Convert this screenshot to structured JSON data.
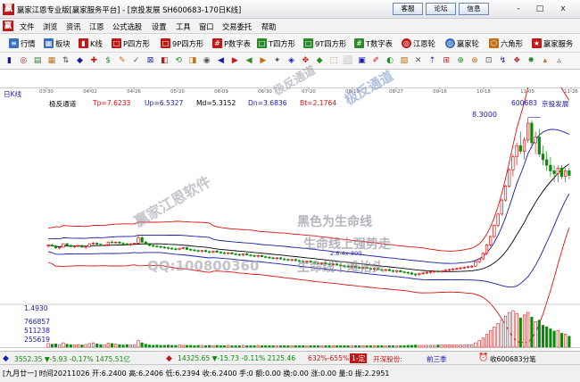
{
  "window": {
    "title": "赢家江恩专业版[赢家服务平台] - [京投发展  SH600683-170日K线]",
    "buttons": [
      "客服",
      "论坛",
      "信息"
    ],
    "controls": [
      "-",
      "□",
      "x"
    ]
  },
  "menu": [
    "文件",
    "浏览",
    "资讯",
    "江恩",
    "公式选股",
    "设置",
    "工具",
    "窗口",
    "交易委托",
    "帮助"
  ],
  "toolbar": [
    "行情",
    "板块",
    "K线",
    "P四方形",
    "9P四方形",
    "P数字表",
    "T四方形",
    "9T四方形",
    "T数字表",
    "江恩轮",
    "赢家轮",
    "六角形",
    "赢家服务"
  ],
  "chart": {
    "period_label": "日K线",
    "date_ticks": [
      "03-30",
      "04-02",
      "04-26",
      "05-20",
      "06-09",
      "06-30",
      "07-20",
      "08-10",
      "08-27",
      "09-16",
      "10-18",
      "11-05",
      "11-26"
    ],
    "indicator_name": "极反通道",
    "indicator_values": [
      {
        "label": "Tp=7.6233",
        "color": "#e01010"
      },
      {
        "label": "Up=6.5327",
        "color": "#1a1aa8"
      },
      {
        "label": "Md=5.3152",
        "color": "#000000"
      },
      {
        "label": "Dn=3.6836",
        "color": "#1a1aa8"
      },
      {
        "label": "Bt=2.1764",
        "color": "#e01010"
      }
    ],
    "stock_code": "600683",
    "stock_name": "京投发展",
    "price_high_label": "8.3000",
    "price_low_label": "2.6-4x-800",
    "volume_labels": [
      "1.4930",
      "766857",
      "511238",
      "255619"
    ]
  },
  "watermarks": {
    "vertical": "极反通道",
    "brand": "赢家江恩软件",
    "qq": "QQ:100800360",
    "black_line": "黑色为生命线",
    "above_line": "生命线上强势走",
    "below_line": "生命线下难抬头"
  },
  "status1": {
    "index1": "3552.35 ▼-5.93 -0.17% 1475.51亿",
    "index2": "14325.65 ▼-15.73 -0.11% 2125.46",
    "pct": "632%-655%",
    "badge": "1-定",
    "open_label": "开深股份:",
    "upcoming": "前三季",
    "stock_name": "收600683分笔"
  },
  "status2": {
    "text": "[九月廿一] 时间20211026 开:6.2400 高:6.2406 低:6.2394 收:6.2400 手:0 额:0.00 换:0.00 涨:0.00 量:0 振:2.2951"
  },
  "colors": {
    "brand": "#c01818",
    "up": "#e01010",
    "down": "#0a8a0a",
    "channel": "#1a1aa8",
    "text_blue": "#1a1aa8"
  },
  "ohlc": [
    [
      3.72,
      3.78,
      3.66,
      3.75
    ],
    [
      3.75,
      3.8,
      3.7,
      3.72
    ],
    [
      3.72,
      3.76,
      3.62,
      3.65
    ],
    [
      3.65,
      3.7,
      3.6,
      3.68
    ],
    [
      3.68,
      3.82,
      3.66,
      3.8
    ],
    [
      3.8,
      3.84,
      3.72,
      3.74
    ],
    [
      3.74,
      3.78,
      3.68,
      3.7
    ],
    [
      3.7,
      3.74,
      3.64,
      3.72
    ],
    [
      3.72,
      3.76,
      3.68,
      3.74
    ],
    [
      3.74,
      3.76,
      3.66,
      3.68
    ],
    [
      3.68,
      3.72,
      3.62,
      3.7
    ],
    [
      3.7,
      3.82,
      3.68,
      3.8
    ],
    [
      3.8,
      3.86,
      3.76,
      3.82
    ],
    [
      3.82,
      3.86,
      3.76,
      3.78
    ],
    [
      3.78,
      3.82,
      3.72,
      3.74
    ],
    [
      3.74,
      3.78,
      3.7,
      3.76
    ],
    [
      3.76,
      3.88,
      3.74,
      3.86
    ],
    [
      3.86,
      3.92,
      3.82,
      3.84
    ],
    [
      3.84,
      3.88,
      3.8,
      3.86
    ],
    [
      3.86,
      3.9,
      3.8,
      3.82
    ],
    [
      3.82,
      3.86,
      3.76,
      3.8
    ],
    [
      3.8,
      3.84,
      3.74,
      3.78
    ],
    [
      3.78,
      3.82,
      3.72,
      3.8
    ],
    [
      3.8,
      3.84,
      3.76,
      3.82
    ],
    [
      3.82,
      4.12,
      3.8,
      4.02
    ],
    [
      4.02,
      4.08,
      3.82,
      3.86
    ],
    [
      3.86,
      3.9,
      3.76,
      3.78
    ],
    [
      3.78,
      3.82,
      3.7,
      3.74
    ],
    [
      3.74,
      3.78,
      3.68,
      3.72
    ],
    [
      3.72,
      3.76,
      3.66,
      3.7
    ],
    [
      3.7,
      3.74,
      3.64,
      3.68
    ],
    [
      3.68,
      3.72,
      3.62,
      3.66
    ],
    [
      3.66,
      3.7,
      3.6,
      3.64
    ],
    [
      3.64,
      3.68,
      3.58,
      3.62
    ],
    [
      3.62,
      3.66,
      3.56,
      3.6
    ],
    [
      3.6,
      3.66,
      3.56,
      3.64
    ],
    [
      3.64,
      3.7,
      3.6,
      3.66
    ],
    [
      3.66,
      3.7,
      3.58,
      3.6
    ],
    [
      3.6,
      3.64,
      3.54,
      3.58
    ],
    [
      3.58,
      3.62,
      3.52,
      3.56
    ],
    [
      3.56,
      3.6,
      3.5,
      3.54
    ],
    [
      3.54,
      3.58,
      3.48,
      3.56
    ],
    [
      3.56,
      3.6,
      3.5,
      3.52
    ],
    [
      3.52,
      3.56,
      3.46,
      3.5
    ],
    [
      3.5,
      3.56,
      3.46,
      3.54
    ],
    [
      3.54,
      3.58,
      3.48,
      3.5
    ],
    [
      3.5,
      3.54,
      3.44,
      3.48
    ],
    [
      3.48,
      3.52,
      3.42,
      3.46
    ],
    [
      3.46,
      3.5,
      3.4,
      3.48
    ],
    [
      3.48,
      3.52,
      3.42,
      3.44
    ],
    [
      3.44,
      3.48,
      3.38,
      3.42
    ],
    [
      3.42,
      3.46,
      3.36,
      3.4
    ],
    [
      3.4,
      3.46,
      3.36,
      3.44
    ],
    [
      3.44,
      3.48,
      3.38,
      3.4
    ],
    [
      3.4,
      3.44,
      3.34,
      3.38
    ],
    [
      3.38,
      3.42,
      3.32,
      3.36
    ],
    [
      3.36,
      3.4,
      3.3,
      3.38
    ],
    [
      3.38,
      3.42,
      3.32,
      3.34
    ],
    [
      3.34,
      3.38,
      3.28,
      3.32
    ],
    [
      3.32,
      3.36,
      3.26,
      3.3
    ],
    [
      3.3,
      3.34,
      3.24,
      3.28
    ],
    [
      3.28,
      3.32,
      3.22,
      3.3
    ],
    [
      3.3,
      3.34,
      3.24,
      3.26
    ],
    [
      3.26,
      3.3,
      3.2,
      3.24
    ],
    [
      3.24,
      3.28,
      3.18,
      3.22
    ],
    [
      3.22,
      3.26,
      3.16,
      3.24
    ],
    [
      3.24,
      3.28,
      3.18,
      3.2
    ],
    [
      3.2,
      3.24,
      3.14,
      3.18
    ],
    [
      3.18,
      3.22,
      3.12,
      3.16
    ],
    [
      3.16,
      3.2,
      3.1,
      3.18
    ],
    [
      3.18,
      3.22,
      3.12,
      3.14
    ],
    [
      3.14,
      3.18,
      3.08,
      3.12
    ],
    [
      3.12,
      3.16,
      3.06,
      3.1
    ],
    [
      3.1,
      3.14,
      3.04,
      3.12
    ],
    [
      3.12,
      3.16,
      3.06,
      3.08
    ],
    [
      3.08,
      3.12,
      3.02,
      3.06
    ],
    [
      3.06,
      3.1,
      3.0,
      3.08
    ],
    [
      3.08,
      3.12,
      3.02,
      3.04
    ],
    [
      3.04,
      3.08,
      2.98,
      3.02
    ],
    [
      3.02,
      3.06,
      2.96,
      3.0
    ],
    [
      3.0,
      3.04,
      2.94,
      2.98
    ],
    [
      2.98,
      3.02,
      2.92,
      3.0
    ],
    [
      3.0,
      3.04,
      2.94,
      2.96
    ],
    [
      2.96,
      3.0,
      2.9,
      2.94
    ],
    [
      2.94,
      2.98,
      2.88,
      2.96
    ],
    [
      2.96,
      3.0,
      2.9,
      2.92
    ],
    [
      2.92,
      2.96,
      2.86,
      2.9
    ],
    [
      2.9,
      2.94,
      2.84,
      2.92
    ],
    [
      2.92,
      2.96,
      2.86,
      2.88
    ],
    [
      2.88,
      2.92,
      2.82,
      2.86
    ],
    [
      2.86,
      2.9,
      2.8,
      2.88
    ],
    [
      2.88,
      2.92,
      2.82,
      2.84
    ],
    [
      2.84,
      2.88,
      2.78,
      2.82
    ],
    [
      2.82,
      2.86,
      2.76,
      2.84
    ],
    [
      2.84,
      2.88,
      2.78,
      2.8
    ],
    [
      2.8,
      2.84,
      2.74,
      2.78
    ],
    [
      2.78,
      2.82,
      2.7,
      2.76
    ],
    [
      2.76,
      2.8,
      2.68,
      2.72
    ],
    [
      2.72,
      2.76,
      2.62,
      2.7
    ],
    [
      2.7,
      2.78,
      2.66,
      2.74
    ],
    [
      2.74,
      2.8,
      2.7,
      2.76
    ],
    [
      2.76,
      2.82,
      2.72,
      2.78
    ],
    [
      2.78,
      2.84,
      2.74,
      2.8
    ],
    [
      2.8,
      2.86,
      2.76,
      2.82
    ],
    [
      2.82,
      2.88,
      2.78,
      2.8
    ],
    [
      2.8,
      2.86,
      2.76,
      2.84
    ],
    [
      2.84,
      2.9,
      2.8,
      2.86
    ],
    [
      2.86,
      2.92,
      2.82,
      2.88
    ],
    [
      2.88,
      2.94,
      2.84,
      2.9
    ],
    [
      2.9,
      2.96,
      2.86,
      2.92
    ],
    [
      2.92,
      2.98,
      2.88,
      2.94
    ],
    [
      2.94,
      3.0,
      2.9,
      2.96
    ],
    [
      2.96,
      3.02,
      2.92,
      2.98
    ],
    [
      2.98,
      3.04,
      2.94,
      3.0
    ],
    [
      3.0,
      3.2,
      2.98,
      3.16
    ],
    [
      3.16,
      3.3,
      3.1,
      3.26
    ],
    [
      3.26,
      3.5,
      3.22,
      3.46
    ],
    [
      3.46,
      3.8,
      3.4,
      3.76
    ],
    [
      3.76,
      4.1,
      3.7,
      4.06
    ],
    [
      4.06,
      4.5,
      4.0,
      4.46
    ],
    [
      4.46,
      4.9,
      4.4,
      4.86
    ],
    [
      4.86,
      5.4,
      4.8,
      5.36
    ],
    [
      5.36,
      5.9,
      5.3,
      5.86
    ],
    [
      5.86,
      6.5,
      5.8,
      6.44
    ],
    [
      6.44,
      7.0,
      6.2,
      6.9
    ],
    [
      6.9,
      7.4,
      6.6,
      7.3
    ],
    [
      7.3,
      7.8,
      7.0,
      7.1
    ],
    [
      7.1,
      7.6,
      6.8,
      7.5
    ],
    [
      7.5,
      8.3,
      7.4,
      8.1
    ],
    [
      8.1,
      8.2,
      7.2,
      7.4
    ],
    [
      7.4,
      7.8,
      7.0,
      7.6
    ],
    [
      7.6,
      7.9,
      6.9,
      7.0
    ],
    [
      7.0,
      7.3,
      6.6,
      6.8
    ],
    [
      6.8,
      7.1,
      6.4,
      6.6
    ],
    [
      6.6,
      6.9,
      6.2,
      6.4
    ],
    [
      6.4,
      6.6,
      6.0,
      6.3
    ],
    [
      6.3,
      6.6,
      6.0,
      6.5
    ],
    [
      6.5,
      6.6,
      6.1,
      6.2
    ],
    [
      6.2,
      6.5,
      6.0,
      6.4
    ],
    [
      6.4,
      6.5,
      6.1,
      6.24
    ]
  ],
  "volume": [
    0.1,
    0.08,
    0.09,
    0.07,
    0.12,
    0.08,
    0.07,
    0.06,
    0.07,
    0.06,
    0.07,
    0.1,
    0.12,
    0.09,
    0.07,
    0.06,
    0.11,
    0.1,
    0.08,
    0.07,
    0.06,
    0.07,
    0.06,
    0.07,
    0.18,
    0.12,
    0.08,
    0.06,
    0.05,
    0.06,
    0.05,
    0.05,
    0.06,
    0.05,
    0.05,
    0.06,
    0.05,
    0.05,
    0.05,
    0.04,
    0.05,
    0.05,
    0.04,
    0.05,
    0.04,
    0.05,
    0.04,
    0.04,
    0.05,
    0.04,
    0.04,
    0.04,
    0.05,
    0.04,
    0.04,
    0.04,
    0.05,
    0.04,
    0.04,
    0.04,
    0.04,
    0.04,
    0.04,
    0.04,
    0.04,
    0.04,
    0.04,
    0.04,
    0.04,
    0.04,
    0.04,
    0.04,
    0.04,
    0.04,
    0.04,
    0.04,
    0.04,
    0.04,
    0.04,
    0.04,
    0.04,
    0.04,
    0.04,
    0.04,
    0.04,
    0.04,
    0.04,
    0.04,
    0.04,
    0.04,
    0.04,
    0.04,
    0.04,
    0.04,
    0.04,
    0.04,
    0.05,
    0.05,
    0.06,
    0.05,
    0.05,
    0.05,
    0.05,
    0.05,
    0.06,
    0.06,
    0.06,
    0.06,
    0.06,
    0.06,
    0.06,
    0.06,
    0.07,
    0.07,
    0.12,
    0.18,
    0.25,
    0.35,
    0.45,
    0.55,
    0.65,
    0.75,
    0.85,
    0.95,
    1.0,
    0.92,
    0.8,
    0.88,
    0.95,
    0.82,
    0.7,
    0.74,
    0.6,
    0.56,
    0.5,
    0.44,
    0.46,
    0.38,
    0.36,
    0.3
  ]
}
